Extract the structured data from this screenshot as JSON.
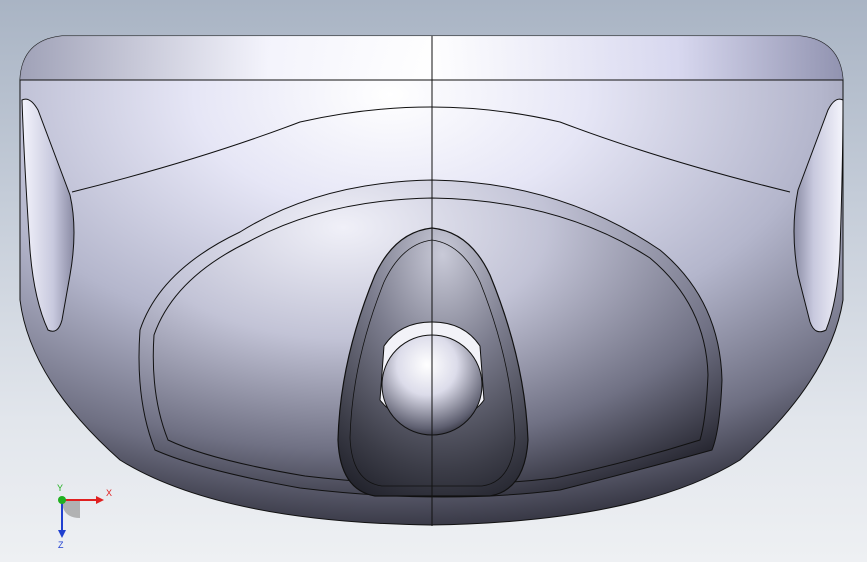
{
  "viewport": {
    "background_top": "#a9b4c4",
    "background_bottom": "#eef0f3"
  },
  "triad": {
    "x_label": "X",
    "y_label": "Y",
    "z_label": "Z",
    "x_color": "#e02020",
    "y_color": "#20b020",
    "z_color": "#2040d0"
  },
  "model": {
    "name_icon": "shell-part-icon",
    "highlight_color": "#ffffff",
    "body_color": "#c7c9e0",
    "shadow_color": "#1a1a24",
    "edge_color": "#0a0a0a"
  }
}
